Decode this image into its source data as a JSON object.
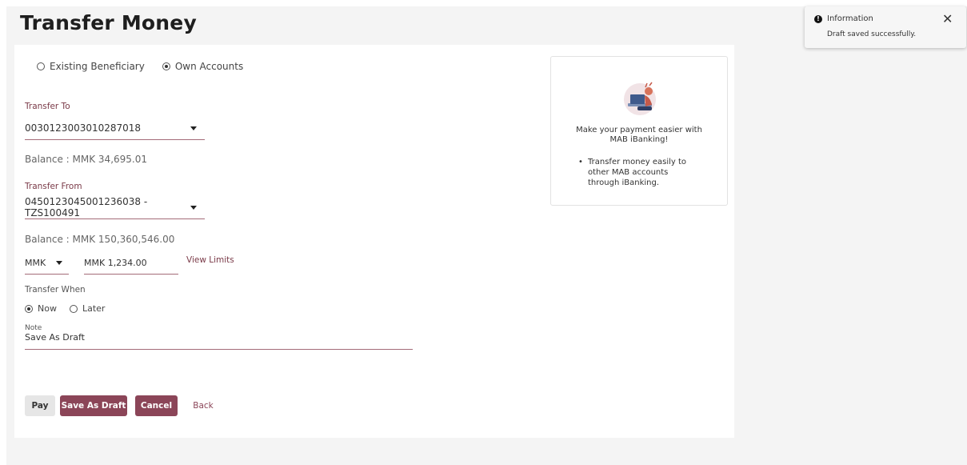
{
  "page": {
    "title": "Transfer Money"
  },
  "beneficiary_type": {
    "options": [
      "Existing Beneficiary",
      "Own Accounts"
    ],
    "selected": "Own Accounts"
  },
  "transfer_to": {
    "label": "Transfer To",
    "value": "0030123003010287018",
    "balance": "Balance : MMK 34,695.01"
  },
  "transfer_from": {
    "label": "Transfer From",
    "value": "0450123045001236038 - TZS100491",
    "balance": "Balance : MMK 150,360,546.00"
  },
  "amount": {
    "currency": "MMK",
    "value": "MMK 1,234.00",
    "view_limits": "View Limits"
  },
  "transfer_when": {
    "label": "Transfer When",
    "options": [
      "Now",
      "Later"
    ],
    "selected": "Now"
  },
  "note": {
    "label": "Note",
    "value": "Save As Draft"
  },
  "actions": {
    "pay": "Pay",
    "save_draft": "Save As Draft",
    "cancel": "Cancel",
    "back": "Back"
  },
  "promo": {
    "title": "Make your payment easier with MAB iBanking!",
    "bullets": [
      "Transfer money easily to other MAB accounts through iBanking."
    ]
  },
  "toast": {
    "title": "Information",
    "message": "Draft saved successfully.",
    "icon": "info-icon"
  },
  "colors": {
    "accent": "#8b4558",
    "label": "#7a3a48",
    "underline": "#a46b78"
  }
}
